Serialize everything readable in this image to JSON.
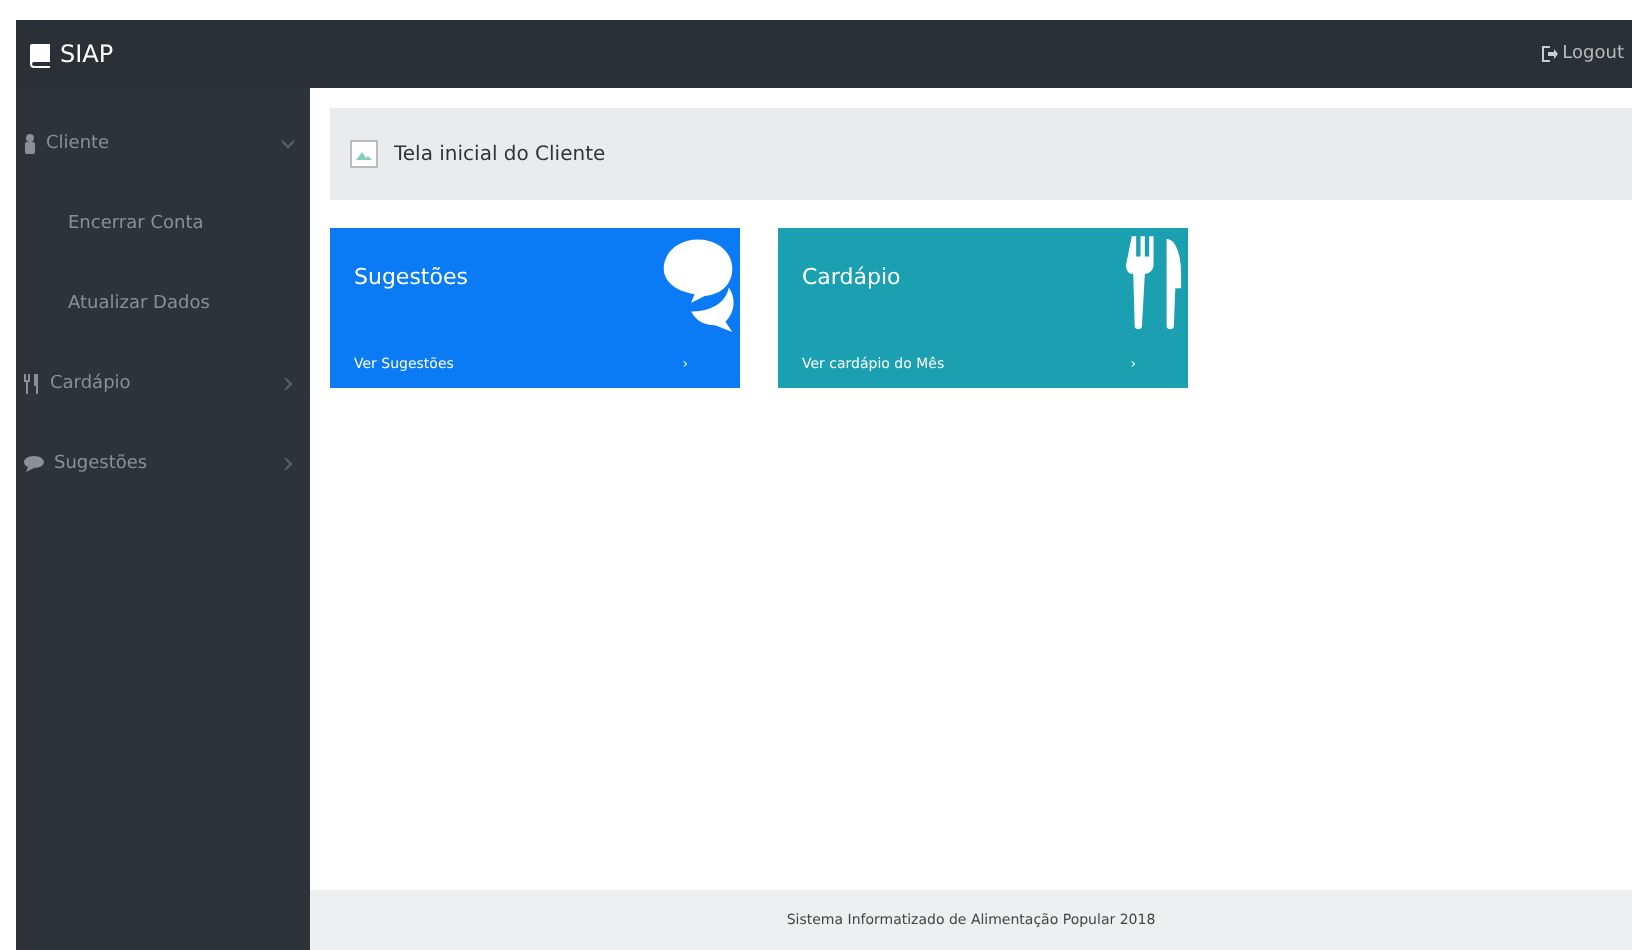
{
  "navbar": {
    "brand": "SIAP",
    "logout": "Logout"
  },
  "sidebar": {
    "items": [
      {
        "label": "Cliente",
        "expanded": true,
        "children": [
          {
            "label": "Encerrar Conta"
          },
          {
            "label": "Atualizar Dados"
          }
        ]
      },
      {
        "label": "Cardápio",
        "expanded": false
      },
      {
        "label": "Sugestões",
        "expanded": false
      }
    ]
  },
  "header": {
    "title": "Tela inicial do Cliente"
  },
  "cards": [
    {
      "title": "Sugestões",
      "link": "Ver Sugestões",
      "link_arrow": "›",
      "color": "#0a7bf5"
    },
    {
      "title": "Cardápio",
      "link": "Ver cardápio do Mês",
      "link_arrow": "›",
      "color": "#1aa0b0"
    }
  ],
  "footer": "Sistema Informatizado de Alimentação Popular 2018"
}
